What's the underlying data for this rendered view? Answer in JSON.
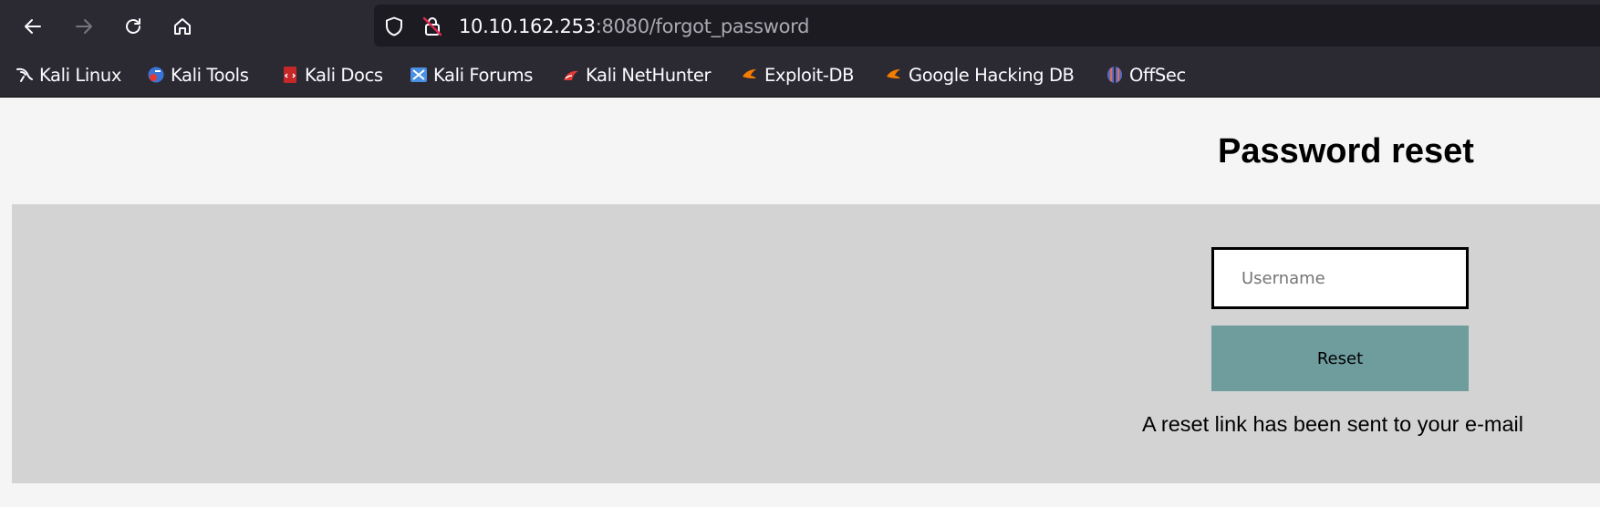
{
  "browser": {
    "url": {
      "host": "10.10.162.253",
      "rest": ":8080/forgot_password"
    },
    "bookmarks": [
      {
        "label": "Kali Linux",
        "icon": "kali-dragon-icon"
      },
      {
        "label": "Kali Tools",
        "icon": "kali-tools-icon"
      },
      {
        "label": "Kali Docs",
        "icon": "kali-docs-icon"
      },
      {
        "label": "Kali Forums",
        "icon": "kali-forums-icon"
      },
      {
        "label": "Kali NetHunter",
        "icon": "kali-nethunter-icon"
      },
      {
        "label": "Exploit-DB",
        "icon": "exploit-db-icon"
      },
      {
        "label": "Google Hacking DB",
        "icon": "exploit-db-icon"
      },
      {
        "label": "OffSec",
        "icon": "offsec-icon"
      }
    ]
  },
  "page": {
    "title": "Password reset",
    "form": {
      "username_placeholder": "Username",
      "username_value": "",
      "reset_label": "Reset"
    },
    "status_message": "A reset link has been sent to your e-mail"
  },
  "colors": {
    "chrome_bg": "#2b2a33",
    "urlbar_bg": "#1c1b22",
    "panel_bg": "#d3d3d3",
    "button_bg": "#6f9c9d"
  }
}
